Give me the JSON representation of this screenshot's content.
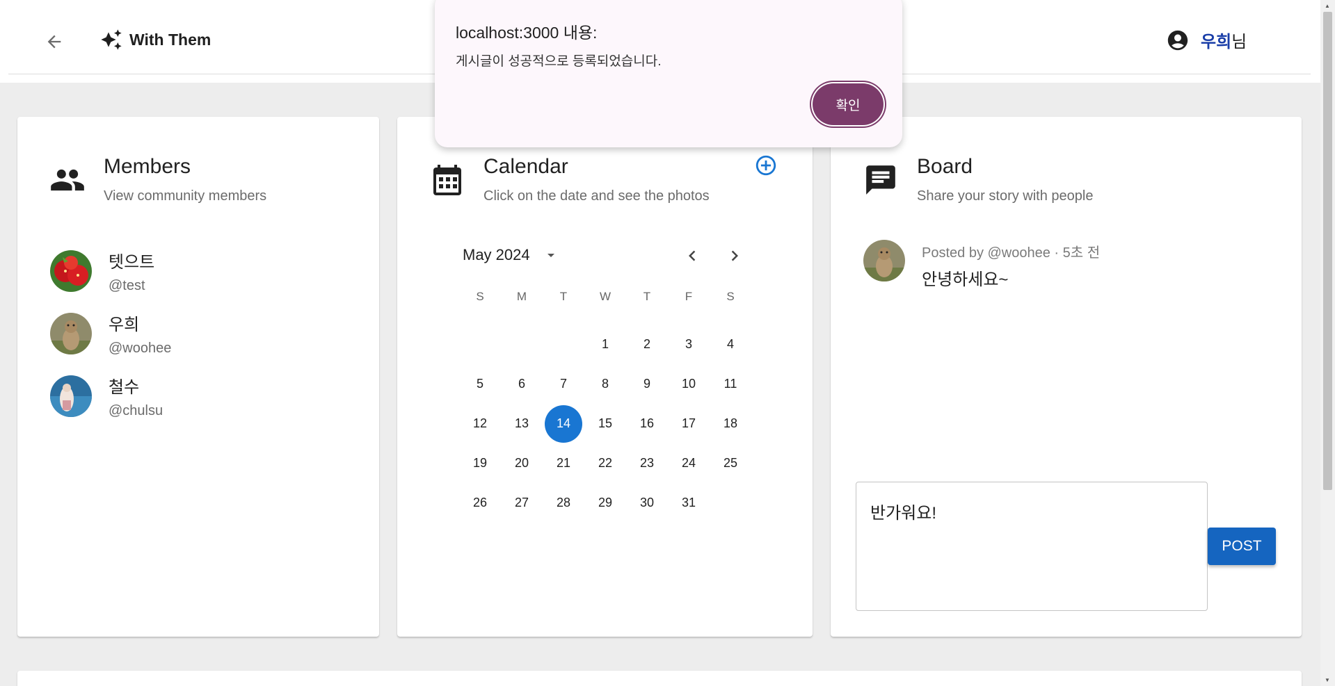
{
  "header": {
    "app_name": "With Them",
    "user_name": "우희",
    "user_suffix": "님"
  },
  "dialog": {
    "title": "localhost:3000 내용:",
    "message": "게시글이 성공적으로 등록되었습니다.",
    "ok_label": "확인"
  },
  "members": {
    "title": "Members",
    "subtitle": "View community members",
    "items": [
      {
        "name": "텟으트",
        "handle": "@test"
      },
      {
        "name": "우희",
        "handle": "@woohee"
      },
      {
        "name": "철수",
        "handle": "@chulsu"
      }
    ]
  },
  "calendar": {
    "title": "Calendar",
    "subtitle": "Click on the date and see the photos",
    "month_label": "May 2024",
    "weekdays": [
      "S",
      "M",
      "T",
      "W",
      "T",
      "F",
      "S"
    ],
    "selected_day": 14,
    "weeks": [
      [
        "",
        "",
        "",
        "1",
        "2",
        "3",
        "4"
      ],
      [
        "5",
        "6",
        "7",
        "8",
        "9",
        "10",
        "11"
      ],
      [
        "12",
        "13",
        "14",
        "15",
        "16",
        "17",
        "18"
      ],
      [
        "19",
        "20",
        "21",
        "22",
        "23",
        "24",
        "25"
      ],
      [
        "26",
        "27",
        "28",
        "29",
        "30",
        "31",
        ""
      ]
    ]
  },
  "board": {
    "title": "Board",
    "subtitle": "Share your story with people",
    "posts": [
      {
        "meta": "Posted by @woohee · 5초 전",
        "body": "안녕하세요~"
      }
    ],
    "input_value": "반가워요!",
    "post_label": "POST"
  },
  "colors": {
    "primary": "#1976d2",
    "dialog_button": "#7b3b6a",
    "user_name": "#1a3ea8"
  }
}
